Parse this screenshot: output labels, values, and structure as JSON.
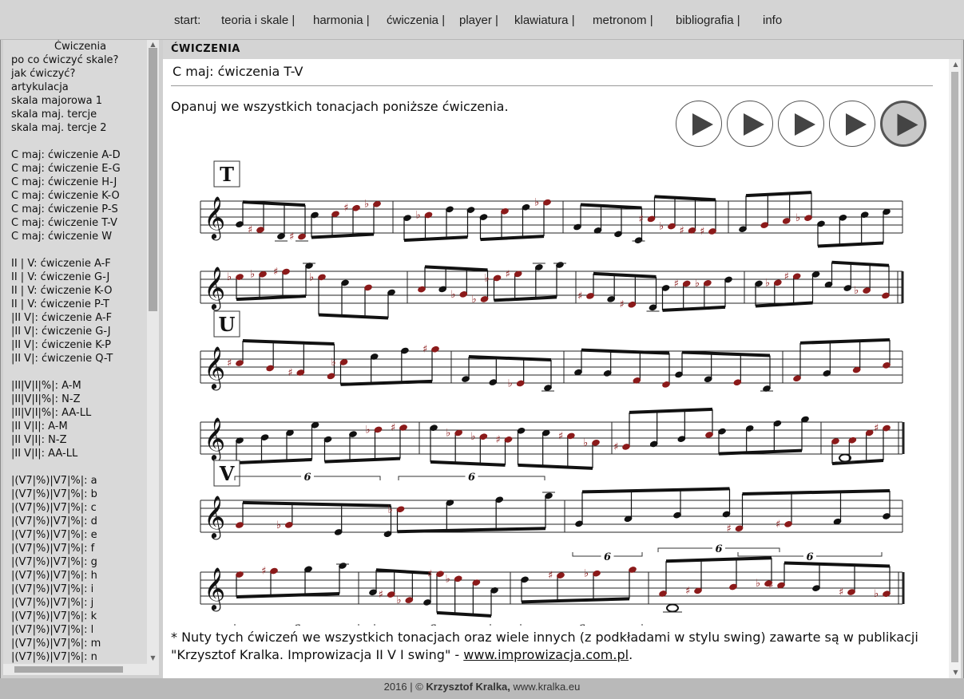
{
  "nav": {
    "items": [
      "start:",
      "teoria i skale |",
      "harmonia |",
      "ćwiczenia |",
      "player |",
      "klawiatura |",
      "metronom |",
      "bibliografia |",
      "info"
    ]
  },
  "sidebar": {
    "lines": [
      "Ćwiczenia",
      "po co ćwiczyć skale?",
      "jak ćwiczyć?",
      "artykulacja",
      "skala majorowa 1",
      "skala maj. tercje",
      "skala maj. tercje 2",
      "",
      "C maj: ćwiczenie A-D",
      "C maj: ćwiczenie E-G",
      "C maj: ćwiczenie H-J",
      "C maj: ćwiczenie K-O",
      "C maj: ćwiczenie P-S",
      "C maj: ćwiczenie T-V",
      "C maj: ćwiczenie W",
      "",
      "II | V: ćwiczenie A-F",
      "II | V: ćwiczenie G-J",
      "II | V: ćwiczenie K-O",
      "II | V: ćwiczenie P-T",
      "|II V|: ćwiczenie A-F",
      "|II V|: ćwiczenie G-J",
      "|II V|: ćwiczenie K-P",
      "|II V|: ćwiczenie Q-T",
      "",
      "|II|V|I|%|: A-M",
      "|II|V|I|%|: N-Z",
      "|II|V|I|%|: AA-LL",
      "|II V|I|: A-M",
      "|II V|I|: N-Z",
      "|II V|I|: AA-LL",
      "",
      "|(V7|%)|V7|%|: a",
      "|(V7|%)|V7|%|: b",
      "|(V7|%)|V7|%|: c",
      "|(V7|%)|V7|%|: d",
      "|(V7|%)|V7|%|: e",
      "|(V7|%)|V7|%|: f",
      "|(V7|%)|V7|%|: g",
      "|(V7|%)|V7|%|: h",
      "|(V7|%)|V7|%|: i",
      "|(V7|%)|V7|%|: j",
      "|(V7|%)|V7|%|: k",
      "|(V7|%)|V7|%|: l",
      "|(V7|%)|V7|%|: m",
      "|(V7|%)|V7|%|: n"
    ]
  },
  "main": {
    "section_title": "ĆWICZENIA",
    "page_title": "C maj: ćwiczenia T-V",
    "intro": "Opanuj we wszystkich tonacjach poniższe ćwiczenia.",
    "play_buttons": 5,
    "exercise_labels": [
      "T",
      "U",
      "V"
    ],
    "tuplet_label": "6",
    "footnote_text": "* Nuty tych ćwiczeń we wszystkich tonacjach oraz wiele innych (z podkładami w stylu swing) zawarte są w publikacji \"Krzysztof Kralka. Improwizacja II V I swing\" - ",
    "footnote_link": "www.improwizacja.com.pl",
    "footnote_end": "."
  },
  "colors": {
    "accent_note": "#8b1a1a",
    "note": "#111111"
  },
  "footer": {
    "year": "2016 | ©",
    "author": "Krzysztof Kralka,",
    "site": "www.kralka.eu"
  }
}
